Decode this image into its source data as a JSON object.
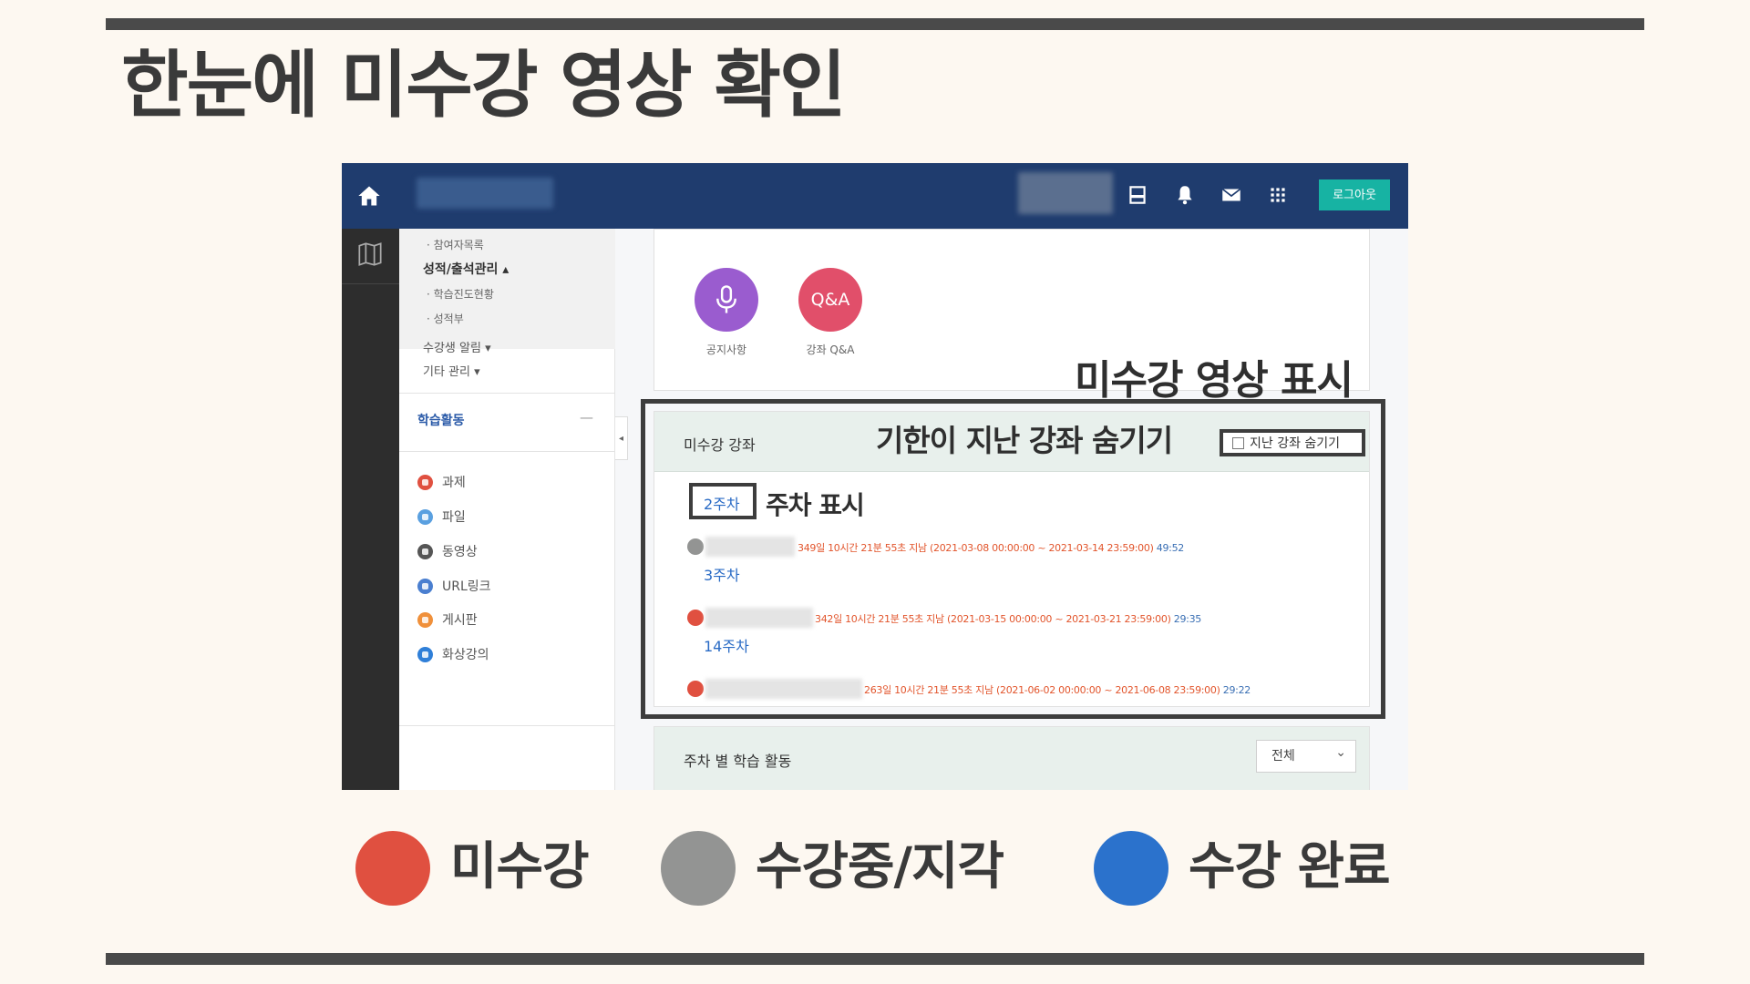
{
  "page_title": "한눈에 미수강 영상 확인",
  "annotations": {
    "missed_display": "미수강 영상 표시",
    "hide_expired": "기한이 지난 강좌 숨기기",
    "week_display": "주차 표시"
  },
  "legend": [
    {
      "label": "미수강",
      "color": "#e05040"
    },
    {
      "label": "수강중/지각",
      "color": "#939493"
    },
    {
      "label": "수강 완료",
      "color": "#2b72cc"
    }
  ],
  "topbar": {
    "logout_label": "로그아웃",
    "colors": {
      "bar": "#1f3c6e",
      "logout": "#17b3a3"
    }
  },
  "sidebar": {
    "sub_items_top": [
      "· 참여자목록"
    ],
    "grades_menu": "성적/출석관리 ▴",
    "grades_sub": [
      "· 학습진도현황",
      "· 성적부"
    ],
    "student_alert_menu": "수강생 알림 ▾",
    "other_menu": "기타 관리 ▾",
    "learning_activity": "학습활동",
    "collapse_symbol": "—",
    "activities": [
      {
        "label": "과제",
        "color": "#e05040"
      },
      {
        "label": "파일",
        "color": "#5aa0e0"
      },
      {
        "label": "동영상",
        "color": "#555555"
      },
      {
        "label": "URL링크",
        "color": "#4a7fd0"
      },
      {
        "label": "게시판",
        "color": "#f0903a"
      },
      {
        "label": "화상강의",
        "color": "#2f7fd8"
      }
    ]
  },
  "main": {
    "quick_icons": [
      {
        "label": "공지사항",
        "symbol": "🎙",
        "color": "#9a5ccf"
      },
      {
        "label": "강좌 Q&A",
        "symbol": "Q&A",
        "color": "#e14f6a"
      }
    ],
    "missed_card": {
      "title": "미수강 강좌",
      "hide_checkbox_label": "지난 강좌 숨기기",
      "weeks": [
        {
          "week": "2주차",
          "status_color": "#939493",
          "info": "349일 10시간 21분 55초 지남 (2021-03-08 00:00:00 ~ 2021-03-14 23:59:00)",
          "length": "49:52"
        },
        {
          "week": "3주차",
          "status_color": "#e05040",
          "info": "342일 10시간 21분 55초 지남 (2021-03-15 00:00:00 ~ 2021-03-21 23:59:00)",
          "length": "29:35"
        },
        {
          "week": "14주차",
          "status_color": "#e05040",
          "info": "263일 10시간 21분 55초 지남 (2021-06-02 00:00:00 ~ 2021-06-08 23:59:00)",
          "length": "29:22"
        }
      ]
    },
    "weekly_card": {
      "title": "주차 별 학습 활동",
      "select_value": "전체"
    }
  }
}
